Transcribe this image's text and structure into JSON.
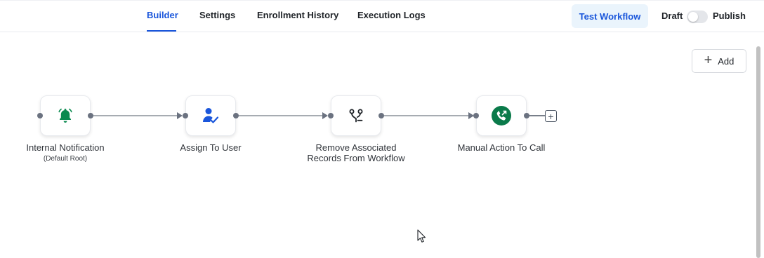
{
  "tabs": [
    {
      "label": "Builder",
      "active": true
    },
    {
      "label": "Settings",
      "active": false
    },
    {
      "label": "Enrollment History",
      "active": false
    },
    {
      "label": "Execution Logs",
      "active": false
    }
  ],
  "header": {
    "test_button": "Test Workflow",
    "draft_label": "Draft",
    "publish_label": "Publish",
    "publish_toggle_on": false
  },
  "canvas": {
    "add_button": "Add",
    "nodes": [
      {
        "label": "Internal Notification",
        "sublabel": "(Default Root)",
        "icon": "bell-icon",
        "icon_color": "#0a8a4f"
      },
      {
        "label": "Assign To User",
        "icon": "user-check-icon",
        "icon_color": "#1a56db"
      },
      {
        "label_line1": "Remove Associated",
        "label_line2": "Records From Workflow",
        "icon": "branch-remove-icon",
        "icon_color": "#1f2328"
      },
      {
        "label": "Manual Action To Call",
        "icon": "phone-outgoing-icon",
        "icon_color": "#0a7a4a"
      }
    ]
  },
  "colors": {
    "accent": "#1a56db",
    "test_button_bg": "#eaf4fc",
    "connector": "#6b7280"
  }
}
